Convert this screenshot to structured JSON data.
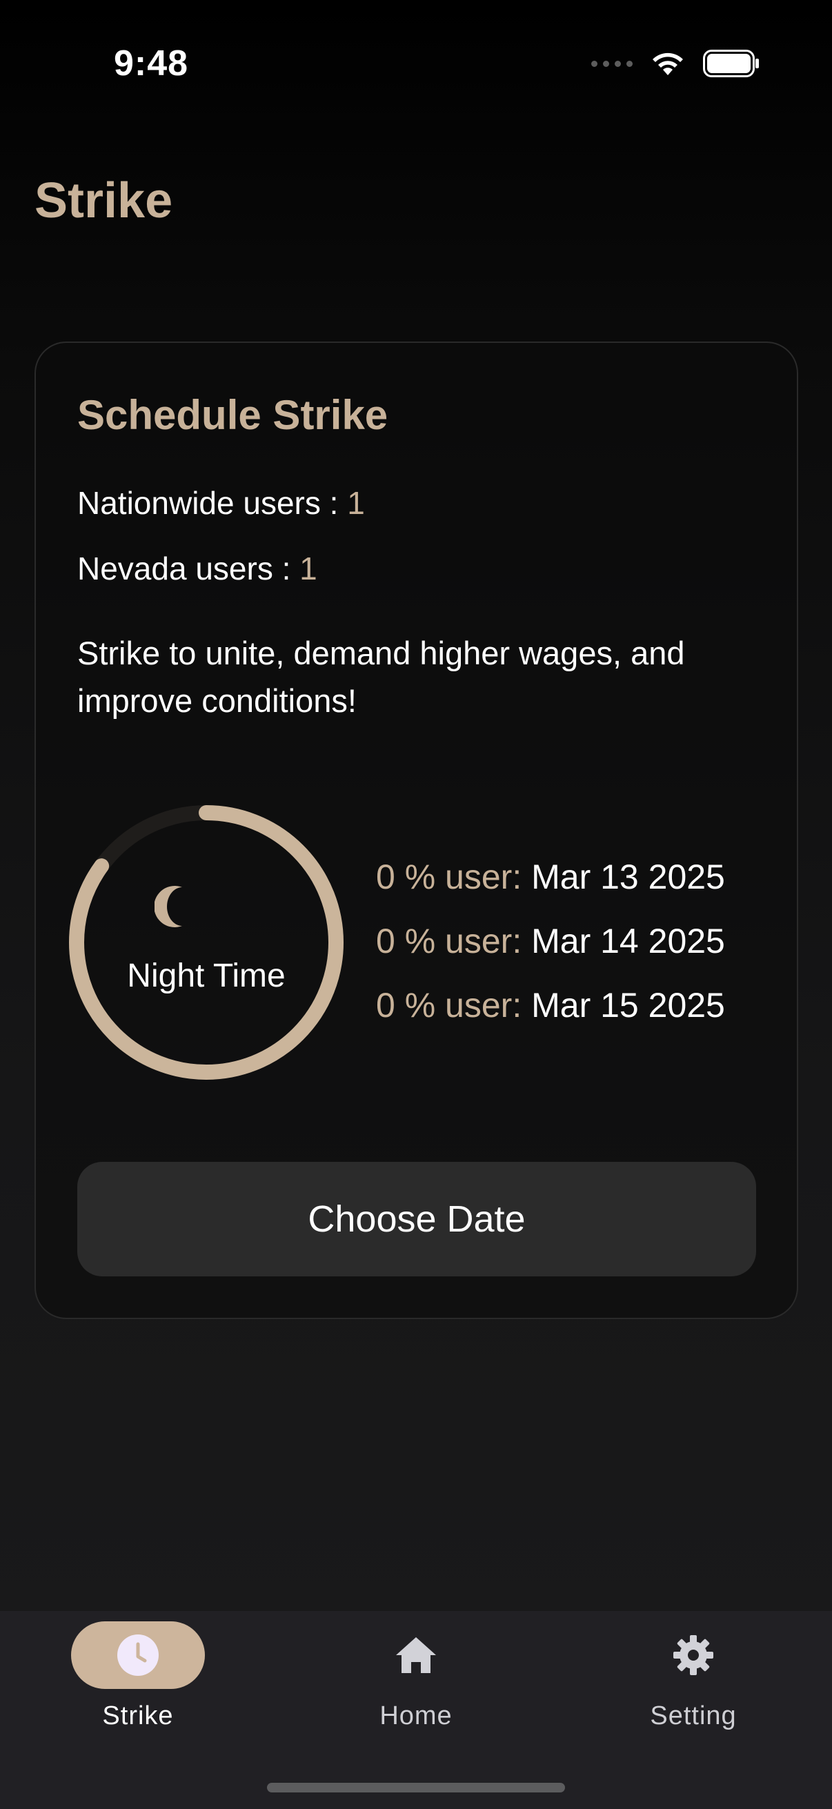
{
  "status_bar": {
    "time": "9:48"
  },
  "header": {
    "title": "Strike"
  },
  "card": {
    "title": "Schedule Strike",
    "nationwide": {
      "label": "Nationwide users : ",
      "value": "1"
    },
    "state": {
      "label": "Nevada users : ",
      "value": "1"
    },
    "slogan": "Strike to unite, demand higher wages, and improve conditions!",
    "ring": {
      "label": "Night Time",
      "icon": "moon-icon",
      "progress_fraction": 0.85
    },
    "date_rows": [
      {
        "percent": "0 % user:",
        "date": "Mar 13 2025"
      },
      {
        "percent": "0 % user:",
        "date": "Mar 14 2025"
      },
      {
        "percent": "0 % user:",
        "date": "Mar 15 2025"
      }
    ],
    "choose_button": "Choose Date"
  },
  "bottom_nav": {
    "items": [
      {
        "label": "Strike",
        "icon": "clock-icon",
        "active": true
      },
      {
        "label": "Home",
        "icon": "home-icon",
        "active": false
      },
      {
        "label": "Setting",
        "icon": "gear-icon",
        "active": false
      }
    ]
  },
  "colors": {
    "accent": "#c8b299",
    "active_pill": "#cdb59c",
    "button_bg": "#2b2b2b",
    "nav_bg": "#212024"
  }
}
